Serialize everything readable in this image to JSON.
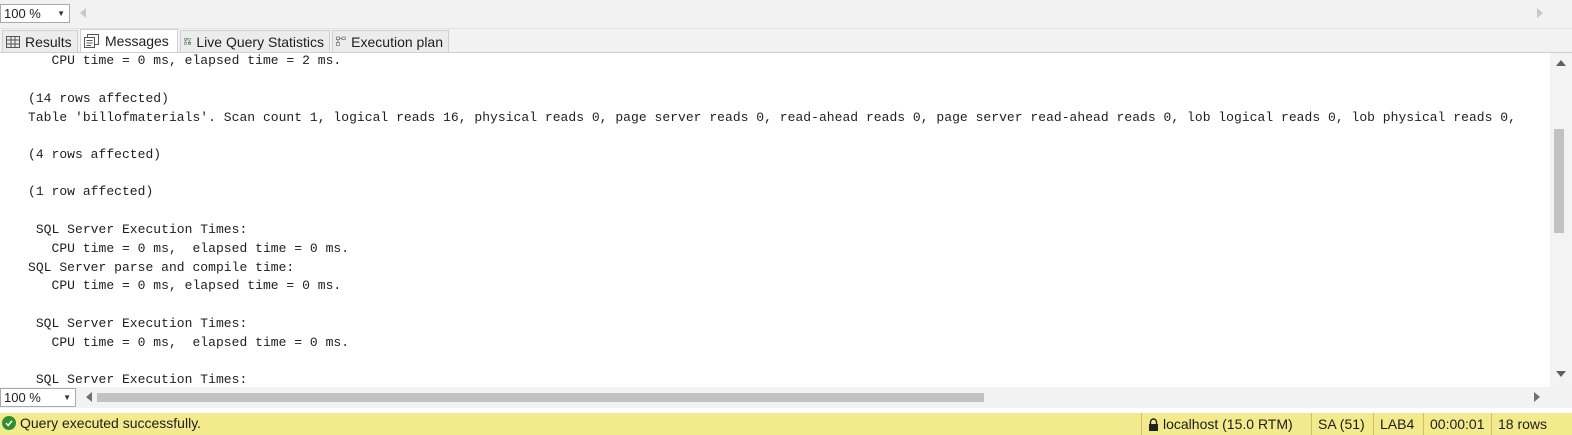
{
  "top_zoom": {
    "value": "100 %"
  },
  "tabs": [
    {
      "label": "Results",
      "icon": "grid-icon",
      "active": false
    },
    {
      "label": "Messages",
      "icon": "messages-icon",
      "active": true
    },
    {
      "label": "Live Query Statistics",
      "icon": "live-query-stats-icon",
      "active": false
    },
    {
      "label": "Execution plan",
      "icon": "execution-plan-icon",
      "active": false
    }
  ],
  "messages": [
    "   CPU time = 0 ms, elapsed time = 2 ms.",
    "",
    "(14 rows affected)",
    "Table 'billofmaterials'. Scan count 1, logical reads 16, physical reads 0, page server reads 0, read-ahead reads 0, page server read-ahead reads 0, lob logical reads 0, lob physical reads 0,",
    "",
    "(4 rows affected)",
    "",
    "(1 row affected)",
    "",
    " SQL Server Execution Times:",
    "   CPU time = 0 ms,  elapsed time = 0 ms.",
    "SQL Server parse and compile time: ",
    "   CPU time = 0 ms, elapsed time = 0 ms.",
    "",
    " SQL Server Execution Times:",
    "   CPU time = 0 ms,  elapsed time = 0 ms.",
    "",
    " SQL Server Execution Times:"
  ],
  "bottom_zoom": {
    "value": "100 %"
  },
  "status": {
    "message": "Query executed successfully.",
    "server": "localhost (15.0 RTM)",
    "user": "SA (51)",
    "database": "LAB4",
    "elapsed": "00:00:01",
    "rows": "18 rows",
    "bar_color": "#f2ea8c",
    "success_color": "#2f8f2f"
  }
}
